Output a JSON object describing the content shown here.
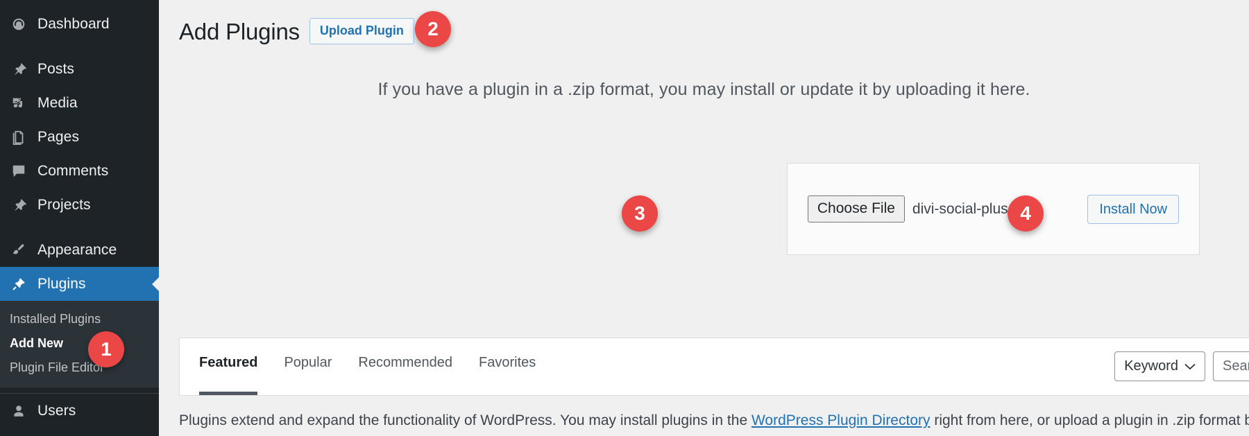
{
  "sidebar": {
    "items": [
      {
        "label": "Dashboard",
        "icon": "dashboard-icon"
      },
      {
        "label": "Posts",
        "icon": "pin-icon"
      },
      {
        "label": "Media",
        "icon": "media-icon"
      },
      {
        "label": "Pages",
        "icon": "pages-icon"
      },
      {
        "label": "Comments",
        "icon": "comments-icon"
      },
      {
        "label": "Projects",
        "icon": "pin-icon"
      },
      {
        "label": "Appearance",
        "icon": "brush-icon"
      },
      {
        "label": "Plugins",
        "icon": "plug-icon"
      },
      {
        "label": "Users",
        "icon": "user-icon"
      }
    ],
    "submenu": [
      {
        "label": "Installed Plugins"
      },
      {
        "label": "Add New"
      },
      {
        "label": "Plugin File Editor"
      }
    ],
    "active_item": "Plugins",
    "active_submenu": "Add New",
    "colors": {
      "background": "#1d2327",
      "submenu_background": "#2c3338",
      "active": "#2271b1"
    }
  },
  "header": {
    "title": "Add Plugins",
    "upload_button": "Upload Plugin"
  },
  "upload": {
    "intro": "If you have a plugin in a .zip format, you may install or update it by uploading it here.",
    "choose_file_label": "Choose File",
    "file_name": "divi-social-plus.zip",
    "install_button": "Install Now"
  },
  "panel": {
    "tabs": [
      {
        "label": "Featured",
        "active": true
      },
      {
        "label": "Popular",
        "active": false
      },
      {
        "label": "Recommended",
        "active": false
      },
      {
        "label": "Favorites",
        "active": false
      }
    ],
    "search": {
      "filter_label": "Keyword",
      "placeholder": "Search plugins..."
    }
  },
  "footer": {
    "text_before": "Plugins extend and expand the functionality of WordPress. You may install plugins in the ",
    "link_text": "WordPress Plugin Directory",
    "text_after": " right from here, or upload a plugin in .zip format by clicking the button"
  },
  "badges": [
    {
      "number": "1"
    },
    {
      "number": "2"
    },
    {
      "number": "3"
    },
    {
      "number": "4"
    }
  ],
  "colors": {
    "badge": "#ec4747",
    "link": "#2271b1",
    "page_background": "#f0f0f1"
  }
}
